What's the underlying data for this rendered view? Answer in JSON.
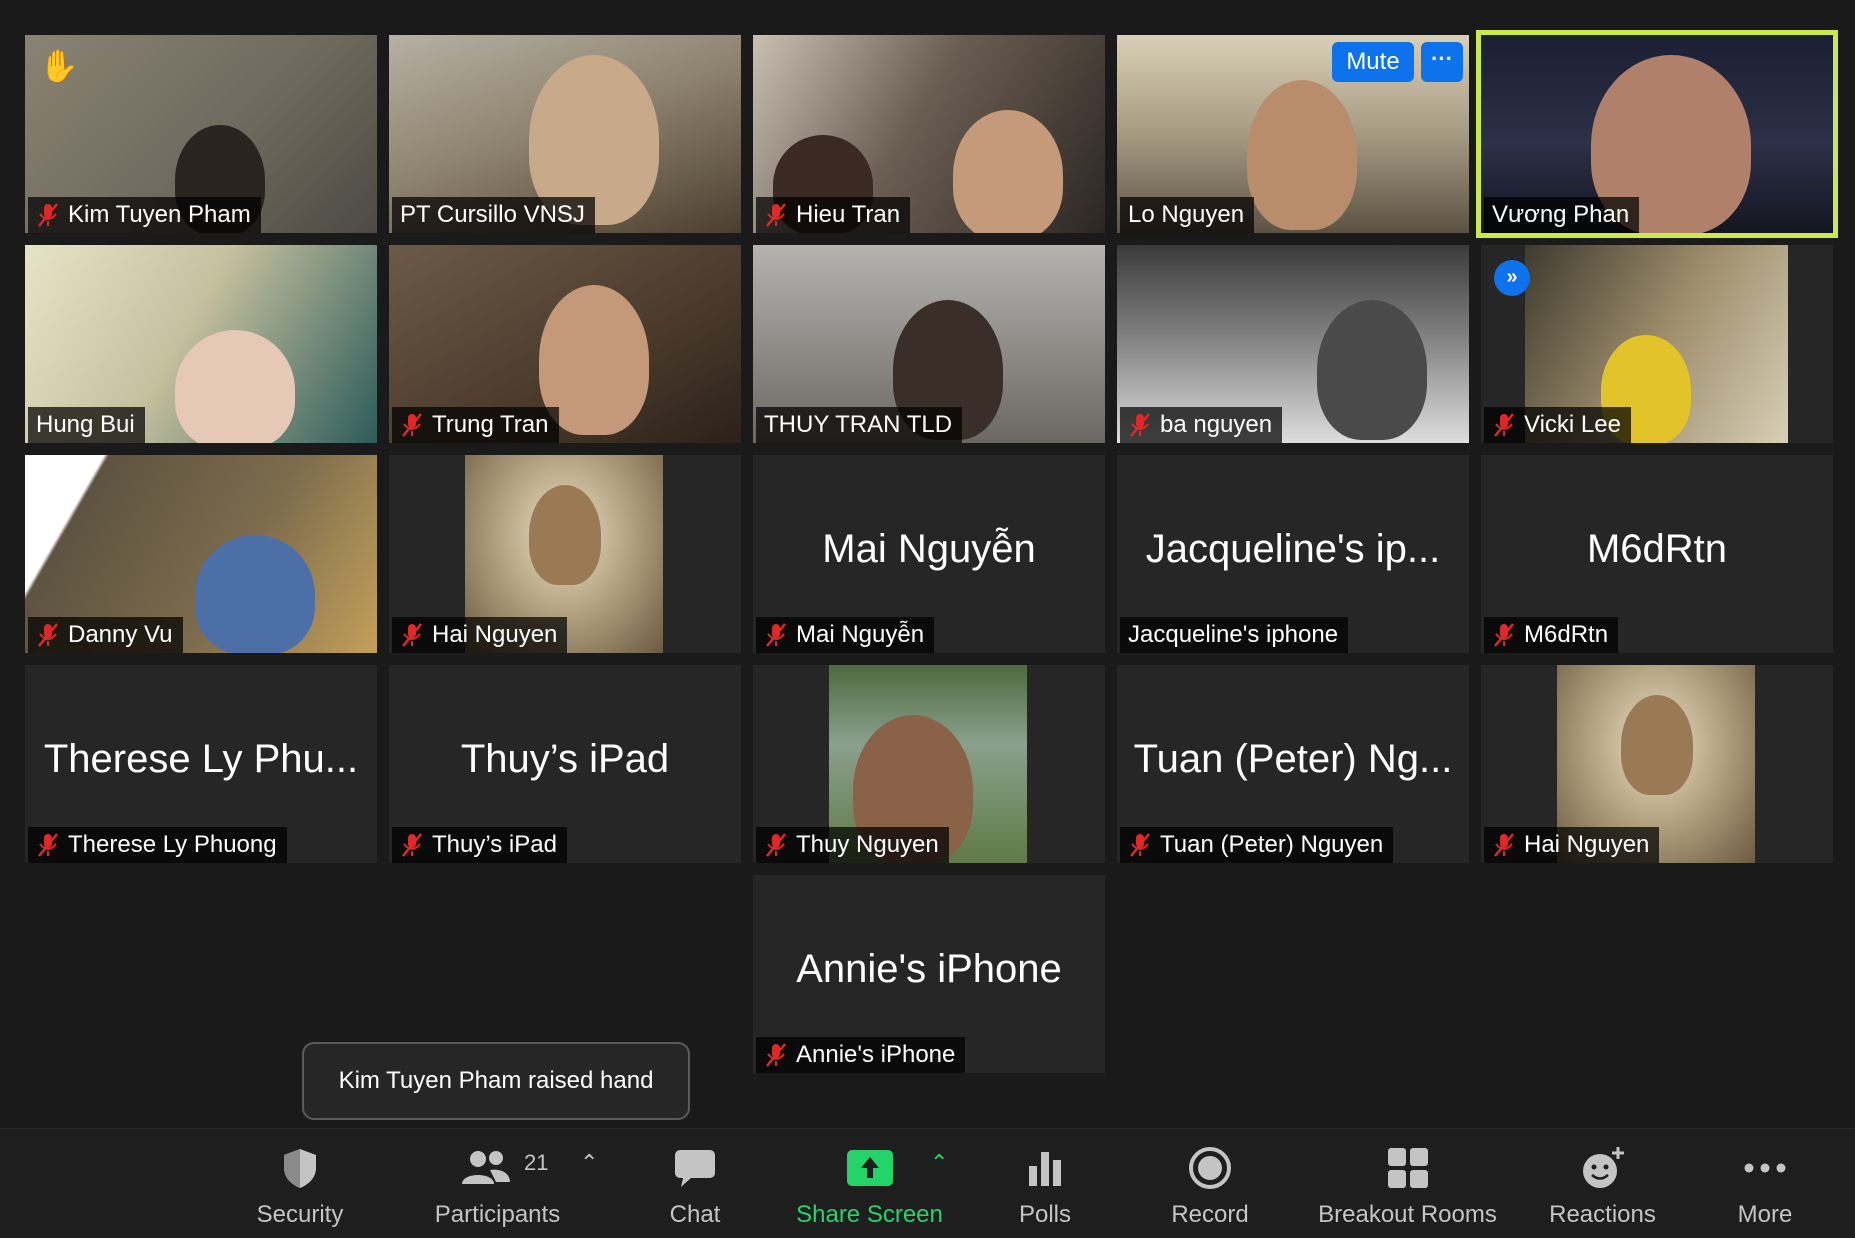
{
  "participants": {
    "p1": "Kim Tuyen Pham",
    "p2": "PT Cursillo VNSJ",
    "p3": "Hieu Tran",
    "p4": "Lo Nguyen",
    "p5": "Vương Phan",
    "p6": "Hung Bui",
    "p7": "Trung Tran",
    "p8": "THUY TRAN TLD",
    "p9": "ba nguyen",
    "p10": "Vicki Lee",
    "p11": "Danny Vu",
    "p12": "Hai Nguyen",
    "p13": "Mai Nguyễn",
    "p13_big": "Mai Nguyễn",
    "p14": "Jacqueline's iphone",
    "p14_big": "Jacqueline's ip...",
    "p15": "M6dRtn",
    "p15_big": "M6dRtn",
    "p16": "Therese Ly Phuong",
    "p16_big": "Therese Ly Phu...",
    "p17": "Thuy’s iPad",
    "p17_big": "Thuy’s iPad",
    "p18": "Thuy Nguyen",
    "p19": "Tuan (Peter) Nguyen",
    "p19_big": "Tuan (Peter) Ng...",
    "p20": "Hai Nguyen",
    "p21": "Annie's iPhone",
    "p21_big": "Annie's iPhone"
  },
  "tile_controls": {
    "mute": "Mute",
    "more": "···"
  },
  "notification": "Kim Tuyen Pham raised hand",
  "toolbar": {
    "security": "Security",
    "participants": "Participants",
    "participant_count": "21",
    "chat": "Chat",
    "share_screen": "Share Screen",
    "polls": "Polls",
    "record": "Record",
    "breakout_rooms": "Breakout Rooms",
    "reactions": "Reactions",
    "more": "More"
  },
  "colors": {
    "active_speaker": "#cde84b",
    "accent_blue": "#0e72ed",
    "share_green": "#24d46b",
    "muted_red": "#e02828"
  }
}
